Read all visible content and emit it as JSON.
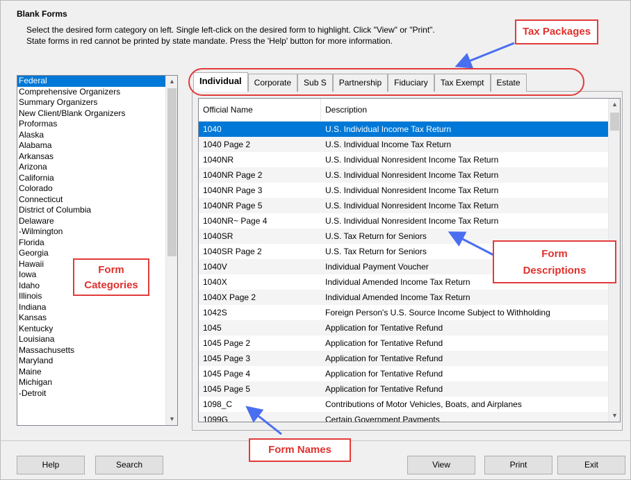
{
  "window": {
    "title": "Blank Forms",
    "instructions": [
      "Select the desired form category on left.  Single left-click on the desired form to highlight. Click \"View\" or \"Print\".",
      "State forms in red cannot be printed by state mandate. Press the 'Help' button for more information."
    ]
  },
  "categories": [
    "Federal",
    "Comprehensive Organizers",
    "Summary Organizers",
    "New Client/Blank Organizers",
    "Proformas",
    "Alaska",
    "Alabama",
    "Arkansas",
    "Arizona",
    "California",
    "Colorado",
    "Connecticut",
    "District of Columbia",
    "Delaware",
    "-Wilmington",
    "Florida",
    "Georgia",
    "Hawaii",
    "Iowa",
    "Idaho",
    "Illinois",
    "Indiana",
    "Kansas",
    "Kentucky",
    "Louisiana",
    "Massachusetts",
    "Maryland",
    "Maine",
    "Michigan",
    "-Detroit"
  ],
  "tabs": [
    "Individual",
    "Corporate",
    "Sub S",
    "Partnership",
    "Fiduciary",
    "Tax Exempt",
    "Estate"
  ],
  "grid": {
    "headers": [
      "Official Name",
      "Description"
    ],
    "rows": [
      [
        "1040",
        "U.S. Individual Income Tax Return"
      ],
      [
        "1040 Page 2",
        "U.S. Individual Income Tax Return"
      ],
      [
        "1040NR",
        "U.S. Individual Nonresident Income Tax Return"
      ],
      [
        "1040NR Page 2",
        "U.S. Individual Nonresident Income Tax Return"
      ],
      [
        "1040NR Page 3",
        "U.S. Individual Nonresident Income Tax Return"
      ],
      [
        "1040NR Page 5",
        "U.S. Individual Nonresident Income Tax Return"
      ],
      [
        "1040NR~ Page 4",
        "U.S. Individual Nonresident Income Tax Return"
      ],
      [
        "1040SR",
        "U.S. Tax Return for Seniors"
      ],
      [
        "1040SR Page 2",
        "U.S. Tax Return for Seniors"
      ],
      [
        "1040V",
        "Individual Payment Voucher"
      ],
      [
        "1040X",
        "Individual Amended Income Tax Return"
      ],
      [
        "1040X Page 2",
        "Individual Amended Income Tax Return"
      ],
      [
        "1042S",
        "Foreign Person's U.S. Source Income Subject to Withholding"
      ],
      [
        "1045",
        "Application for Tentative Refund"
      ],
      [
        "1045 Page 2",
        "Application for Tentative Refund"
      ],
      [
        "1045 Page 3",
        "Application for Tentative Refund"
      ],
      [
        "1045 Page 4",
        "Application for Tentative Refund"
      ],
      [
        "1045 Page 5",
        "Application for Tentative Refund"
      ],
      [
        "1098_C",
        "Contributions of Motor Vehicles, Boats, and Airplanes"
      ],
      [
        "1099G",
        "Certain Government Payments"
      ]
    ]
  },
  "buttons": {
    "help": "Help",
    "search": "Search",
    "view": "View",
    "print": "Print",
    "exit": "Exit"
  },
  "annotations": {
    "tax_packages": "Tax Packages",
    "form_categories": [
      "Form",
      "Categories"
    ],
    "form_descriptions": [
      "Form",
      "Descriptions"
    ],
    "form_names": "Form Names"
  },
  "colors": {
    "selection": "#0078d7",
    "annotation": "#e23a3a",
    "arrow": "#4a6ef0"
  }
}
